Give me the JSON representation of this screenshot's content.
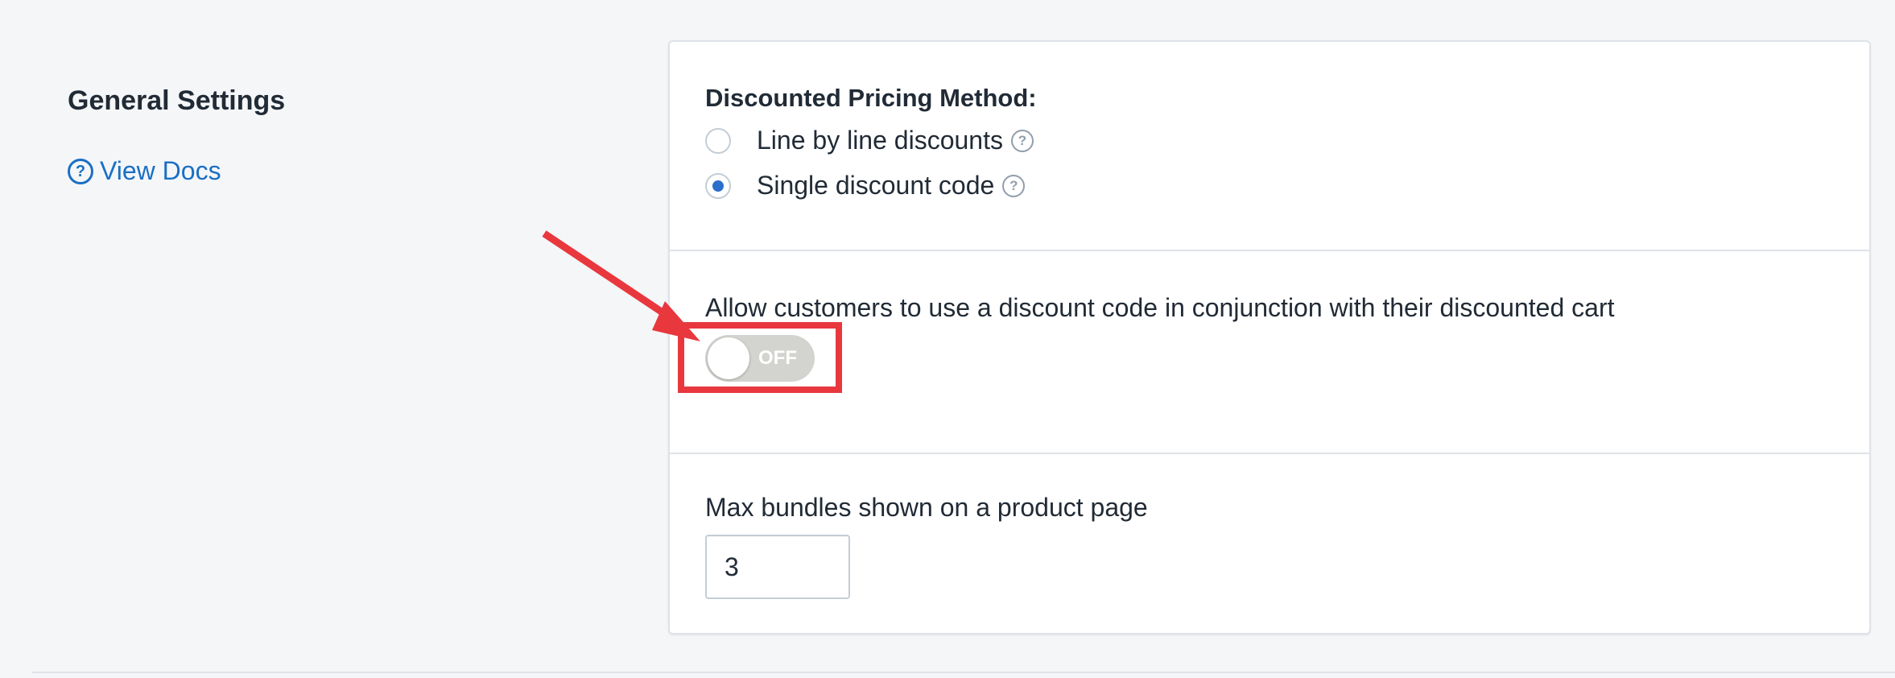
{
  "left": {
    "title": "General Settings",
    "docs_link": "View Docs"
  },
  "pricing": {
    "label": "Discounted Pricing Method:",
    "options": [
      {
        "label": "Line by line discounts",
        "checked": false
      },
      {
        "label": "Single discount code",
        "checked": true
      }
    ]
  },
  "combine": {
    "label": "Allow customers to use a discount code in conjunction with their discounted cart",
    "toggle_text": "OFF",
    "toggle_on": false
  },
  "max_bundles": {
    "label": "Max bundles shown on a product page",
    "value": "3"
  },
  "colors": {
    "link": "#1a6fc4",
    "radio_selected": "#2c6ecb",
    "annotation": "#e8383d",
    "toggle_off": "#d3d3cf"
  },
  "icons": {
    "help": "question-circle-icon"
  }
}
